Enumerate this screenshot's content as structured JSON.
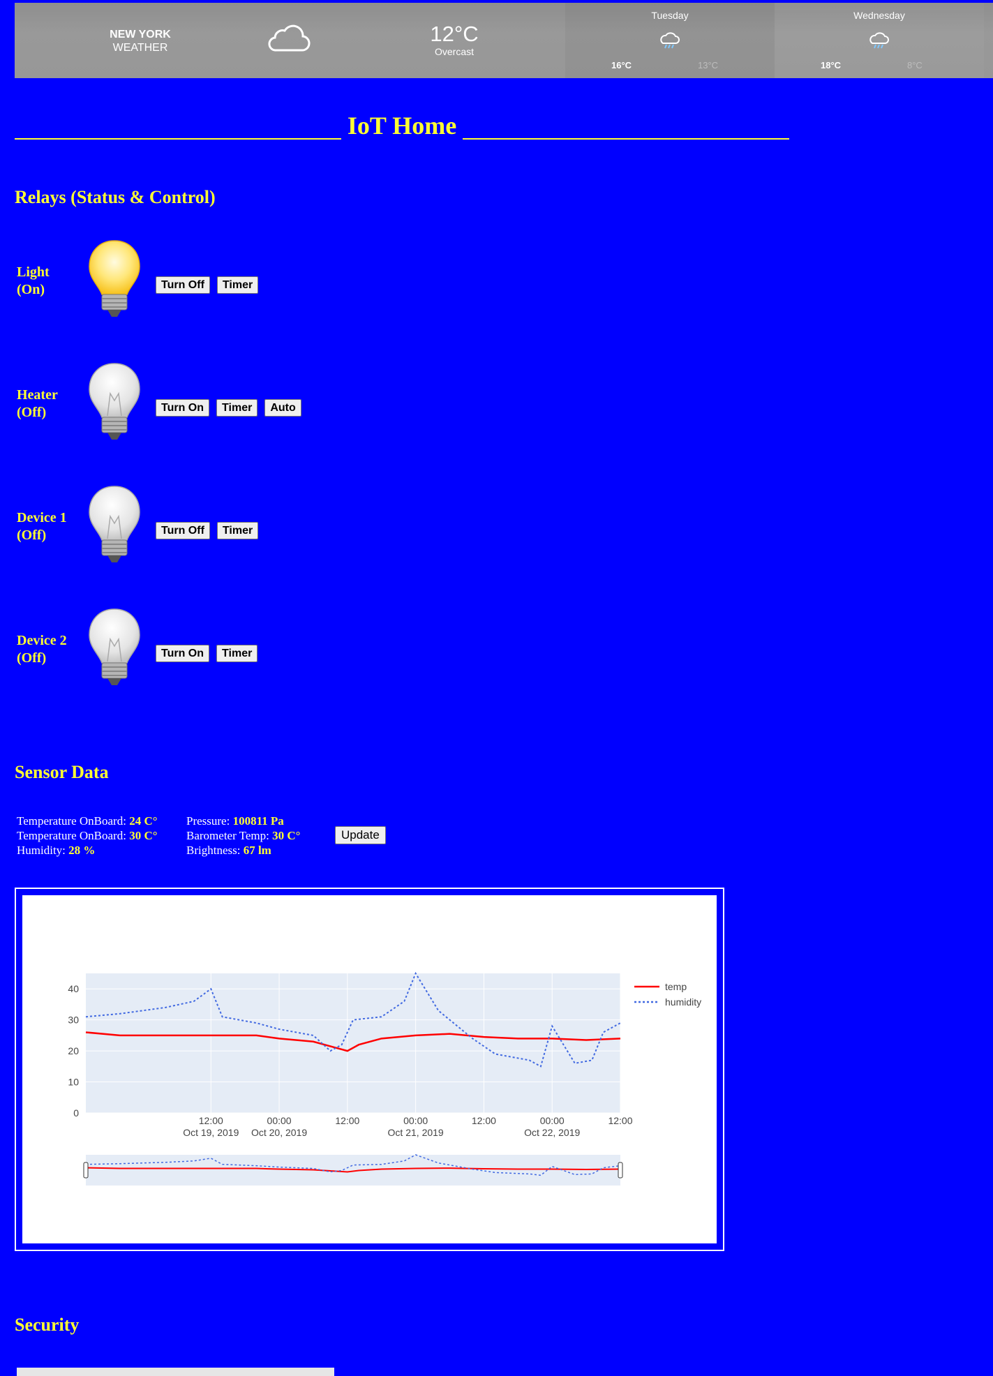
{
  "weather": {
    "city": "NEW YORK",
    "label": "WEATHER",
    "current_icon": "cloud-icon",
    "temp": "12°C",
    "desc": "Overcast",
    "forecast": [
      {
        "day": "Tuesday",
        "icon": "rain-cloud-icon",
        "high": "16°C",
        "low": "13°C"
      },
      {
        "day": "Wednesday",
        "icon": "rain-cloud-icon",
        "high": "18°C",
        "low": "8°C"
      }
    ]
  },
  "title": "IoT Home",
  "relays": {
    "heading": "Relays (Status & Control)",
    "items": [
      {
        "name": "Light",
        "status": "(On)",
        "on": true,
        "buttons": [
          "Turn Off",
          "Timer"
        ]
      },
      {
        "name": "Heater",
        "status": "(Off)",
        "on": false,
        "buttons": [
          "Turn On",
          "Timer",
          "Auto"
        ]
      },
      {
        "name": "Device 1",
        "status": "(Off)",
        "on": false,
        "buttons": [
          "Turn Off",
          "Timer"
        ]
      },
      {
        "name": "Device 2",
        "status": "(Off)",
        "on": false,
        "buttons": [
          "Turn On",
          "Timer"
        ]
      }
    ]
  },
  "sensors": {
    "heading": "Sensor Data",
    "col1": [
      {
        "label": "Temperature OnBoard:",
        "value": "24 C°"
      },
      {
        "label": "Temperature OnBoard:",
        "value": "30 C°"
      },
      {
        "label": "Humidity:",
        "value": "28 %"
      }
    ],
    "col2": [
      {
        "label": "Pressure:",
        "value": "100811 Pa"
      },
      {
        "label": "Barometer Temp:",
        "value": "30 C°"
      },
      {
        "label": "Brightness:",
        "value": "67 lm"
      }
    ],
    "update_label": "Update"
  },
  "chart_data": {
    "type": "line",
    "x_start": "2019-10-18T14:00",
    "x_end": "2019-10-22T12:00",
    "ylim": [
      0,
      45
    ],
    "yticks": [
      0,
      10,
      20,
      30,
      40
    ],
    "xticks": [
      {
        "t": "2019-10-19T12:00",
        "l1": "12:00",
        "l2": "Oct 19, 2019"
      },
      {
        "t": "2019-10-20T00:00",
        "l1": "00:00",
        "l2": "Oct 20, 2019"
      },
      {
        "t": "2019-10-20T12:00",
        "l1": "12:00",
        "l2": ""
      },
      {
        "t": "2019-10-21T00:00",
        "l1": "00:00",
        "l2": "Oct 21, 2019"
      },
      {
        "t": "2019-10-21T12:00",
        "l1": "12:00",
        "l2": ""
      },
      {
        "t": "2019-10-22T00:00",
        "l1": "00:00",
        "l2": "Oct 22, 2019"
      },
      {
        "t": "2019-10-22T12:00",
        "l1": "12:00",
        "l2": ""
      }
    ],
    "grid": true,
    "legend_position": "top-right",
    "range_slider": true,
    "series": [
      {
        "name": "temp",
        "color": "#ff0000",
        "dash": "solid",
        "points": [
          [
            "2019-10-18T14:00",
            26
          ],
          [
            "2019-10-18T20:00",
            25
          ],
          [
            "2019-10-19T04:00",
            25
          ],
          [
            "2019-10-19T12:00",
            25
          ],
          [
            "2019-10-19T20:00",
            25
          ],
          [
            "2019-10-20T00:00",
            24
          ],
          [
            "2019-10-20T06:00",
            23
          ],
          [
            "2019-10-20T10:00",
            21
          ],
          [
            "2019-10-20T12:00",
            20
          ],
          [
            "2019-10-20T14:00",
            22
          ],
          [
            "2019-10-20T18:00",
            24
          ],
          [
            "2019-10-21T00:00",
            25
          ],
          [
            "2019-10-21T06:00",
            25.5
          ],
          [
            "2019-10-21T12:00",
            24.5
          ],
          [
            "2019-10-21T18:00",
            24
          ],
          [
            "2019-10-22T00:00",
            24
          ],
          [
            "2019-10-22T06:00",
            23.5
          ],
          [
            "2019-10-22T12:00",
            24
          ]
        ]
      },
      {
        "name": "humidity",
        "color": "#4169e1",
        "dash": "dotted",
        "points": [
          [
            "2019-10-18T14:00",
            31
          ],
          [
            "2019-10-18T20:00",
            32
          ],
          [
            "2019-10-19T04:00",
            34
          ],
          [
            "2019-10-19T09:00",
            36
          ],
          [
            "2019-10-19T12:00",
            40
          ],
          [
            "2019-10-19T14:00",
            31
          ],
          [
            "2019-10-19T20:00",
            29
          ],
          [
            "2019-10-20T00:00",
            27
          ],
          [
            "2019-10-20T06:00",
            25
          ],
          [
            "2019-10-20T09:00",
            20
          ],
          [
            "2019-10-20T11:00",
            22
          ],
          [
            "2019-10-20T13:00",
            30
          ],
          [
            "2019-10-20T18:00",
            31
          ],
          [
            "2019-10-20T22:00",
            36
          ],
          [
            "2019-10-21T00:00",
            45
          ],
          [
            "2019-10-21T04:00",
            33
          ],
          [
            "2019-10-21T10:00",
            24
          ],
          [
            "2019-10-21T14:00",
            19
          ],
          [
            "2019-10-21T20:00",
            17
          ],
          [
            "2019-10-21T22:00",
            15
          ],
          [
            "2019-10-22T00:00",
            28
          ],
          [
            "2019-10-22T04:00",
            16
          ],
          [
            "2019-10-22T07:00",
            17
          ],
          [
            "2019-10-22T09:00",
            26
          ],
          [
            "2019-10-22T12:00",
            29
          ]
        ]
      }
    ]
  },
  "security": {
    "heading": "Security"
  }
}
